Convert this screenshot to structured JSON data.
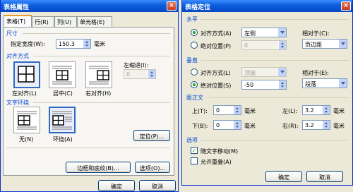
{
  "left_dialog": {
    "title": "表格属性",
    "tabs": [
      "表格(T)",
      "行(R)",
      "列(U)",
      "单元格(E)"
    ],
    "size_section": "尺寸",
    "preferred_width_label": "指定宽度(W):",
    "preferred_width_value": "150.3",
    "unit": "毫米",
    "alignment_section": "对齐方式",
    "align_left": "左对齐(L)",
    "align_center": "居中(C)",
    "align_right": "右对齐(H)",
    "indent_label": "左缩进(I):",
    "indent_value": "0",
    "wrap_section": "文字环绕",
    "wrap_none": "无(N)",
    "wrap_around": "环绕(A)",
    "positioning_button": "定位(P)...",
    "borders_button": "边框和底纹(B)...",
    "options_button": "选项(O)...",
    "ok_button": "确定",
    "cancel_button": "取消",
    "close_glyph": "×"
  },
  "right_dialog": {
    "title": "表格定位",
    "horizontal_section": "水平",
    "h_align_label": "对齐方式(A)",
    "h_align_value": "左侧",
    "h_abs_label": "绝对位置(P)",
    "h_abs_value": "0",
    "h_relative_label": "相对于(C):",
    "h_relative_value": "页边距",
    "vertical_section": "垂直",
    "v_align_label": "对齐方式(L)",
    "v_align_value": "顶端",
    "v_abs_label": "绝对位置(S)",
    "v_abs_value": "-50",
    "v_relative_label": "相对于(E):",
    "v_relative_value": "段落",
    "distance_section": "距正文",
    "top_label": "上(T):",
    "top_value": "0",
    "bottom_label": "下(B):",
    "bottom_value": "0",
    "left_label": "左(L):",
    "left_value": "3.2",
    "right_label": "右(R):",
    "right_value": "3.2",
    "unit": "毫米",
    "options_section": "选项",
    "move_with_text": "随文字移动(M)",
    "allow_overlap": "允许重叠(A)",
    "move_with_text_checked": true,
    "allow_overlap_checked": false,
    "ok_button": "确定",
    "cancel_button": "取消",
    "close_glyph": "×"
  },
  "colors": {
    "title_blue": "#0a5ddc",
    "section_blue": "#0046d5",
    "selection": "#316ac5"
  }
}
